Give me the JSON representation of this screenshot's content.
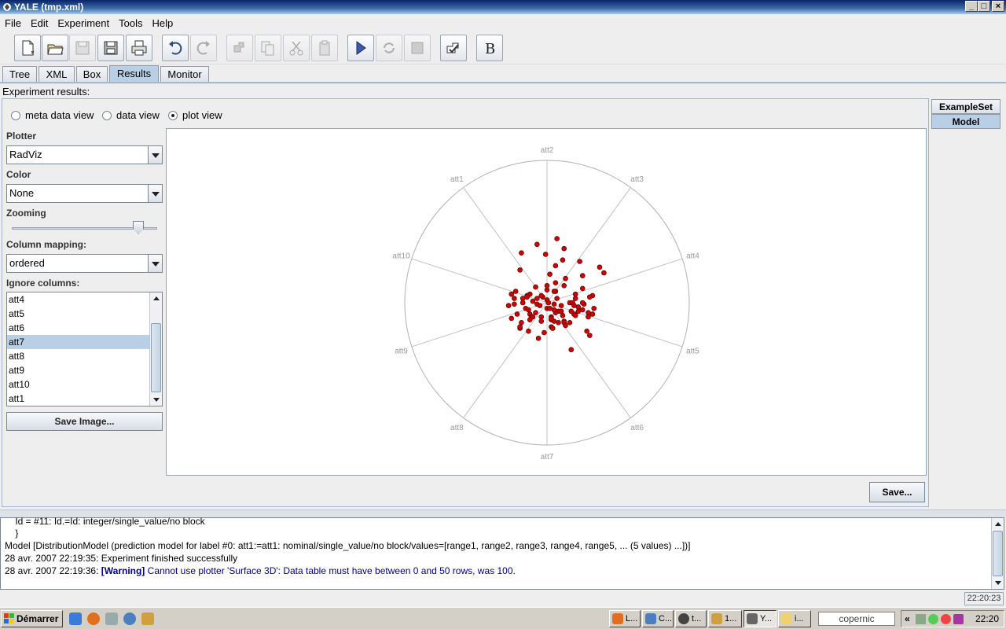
{
  "window": {
    "title": "YALE (tmp.xml)",
    "controls": [
      "_",
      "□",
      "×"
    ]
  },
  "menu": [
    "File",
    "Edit",
    "Experiment",
    "Tools",
    "Help"
  ],
  "toolbar": {
    "buttons": [
      {
        "name": "new-icon",
        "enabled": true
      },
      {
        "name": "open-icon",
        "enabled": true
      },
      {
        "name": "save-icon",
        "enabled": false
      },
      {
        "name": "save-as-icon",
        "enabled": true
      },
      {
        "name": "print-icon",
        "enabled": true
      },
      {
        "name": "undo-icon",
        "enabled": true
      },
      {
        "name": "redo-icon",
        "enabled": false
      },
      {
        "name": "wizard-icon",
        "enabled": false
      },
      {
        "name": "copy-icon",
        "enabled": false
      },
      {
        "name": "cut-icon",
        "enabled": false
      },
      {
        "name": "paste-icon",
        "enabled": false
      },
      {
        "name": "run-icon",
        "enabled": true
      },
      {
        "name": "resume-icon",
        "enabled": false
      },
      {
        "name": "stop-icon",
        "enabled": false
      },
      {
        "name": "validate-icon",
        "enabled": true
      },
      {
        "name": "breakpoint-icon",
        "enabled": true
      }
    ]
  },
  "tabs": [
    {
      "label": "Tree"
    },
    {
      "label": "XML"
    },
    {
      "label": "Box"
    },
    {
      "label": "Results",
      "active": true
    },
    {
      "label": "Monitor"
    }
  ],
  "results": {
    "title": "Experiment results:",
    "views": [
      {
        "label": "meta data view",
        "selected": false
      },
      {
        "label": "data view",
        "selected": false
      },
      {
        "label": "plot view",
        "selected": true
      }
    ],
    "side_tabs": [
      {
        "label": "ExampleSet"
      },
      {
        "label": "Model",
        "active": true
      }
    ],
    "save_label": "Save..."
  },
  "plotter": {
    "plotter_label": "Plotter",
    "plotter_value": "RadViz",
    "color_label": "Color",
    "color_value": "None",
    "zooming_label": "Zooming",
    "zoom_fraction": 0.88,
    "mapping_label": "Column mapping:",
    "mapping_value": "ordered",
    "ignore_label": "Ignore columns:",
    "ignore_items": [
      "att4",
      "att5",
      "att6",
      "att7",
      "att8",
      "att9",
      "att10",
      "att1"
    ],
    "ignore_selected": "att7",
    "save_image_label": "Save Image..."
  },
  "chart_data": {
    "type": "scatter",
    "plot": "RadViz",
    "anchors": [
      "att2",
      "att3",
      "att4",
      "att5",
      "att6",
      "att7",
      "att8",
      "att9",
      "att10",
      "att1"
    ],
    "point_color": "#cc0000",
    "x": [
      0.07,
      0.12,
      -0.01,
      0.23,
      0.37,
      0.11,
      0.06,
      -0.19,
      0.4,
      0.25,
      0.13,
      0.06,
      0.02,
      -0.08,
      0.25,
      0.12,
      0.06,
      0.0,
      -0.12,
      -0.22,
      -0.25,
      -0.23,
      0.32,
      -0.14,
      -0.07,
      0.2,
      0.0,
      0.16,
      0.3,
      0.2,
      0.07,
      -0.17,
      -0.17,
      -0.23,
      -0.07,
      -0.05,
      0.26,
      0.18,
      0.19,
      0.22,
      0.22,
      0.33,
      0.25,
      0.29,
      0.19,
      0.29,
      0.32,
      0.11,
      -0.04,
      0.08,
      -0.21,
      -0.25,
      -0.12,
      -0.15,
      -0.11,
      0.08,
      0.12,
      -0.1,
      0.03,
      -0.12,
      -0.18,
      -0.19,
      -0.19,
      0.28,
      0.12,
      0.13,
      0.03,
      0.05,
      0.03,
      0.06,
      0.05,
      0.17,
      0.1,
      0.0,
      -0.13,
      0.05,
      0.25,
      0.02,
      -0.08,
      -0.04,
      -0.03,
      -0.1,
      -0.14,
      0.0,
      0.05,
      0.01,
      -0.04,
      -0.13,
      -0.27,
      0.03,
      0.1,
      0.04,
      -0.02,
      -0.06,
      0.16,
      0.2,
      0.3,
      -0.07,
      -0.18,
      0.17
    ],
    "y": [
      0.45,
      0.38,
      0.34,
      0.29,
      0.25,
      0.3,
      0.26,
      0.23,
      0.21,
      0.19,
      0.17,
      0.14,
      0.2,
      0.11,
      0.1,
      0.12,
      0.08,
      0.09,
      0.06,
      0.08,
      0.06,
      0.03,
      0.05,
      0.05,
      0.03,
      0.06,
      0.02,
      0.0,
      0.04,
      0.03,
      0.03,
      0.03,
      0.0,
      -0.01,
      -0.01,
      -0.02,
      -0.01,
      0.0,
      -0.02,
      -0.03,
      -0.06,
      -0.04,
      -0.05,
      -0.07,
      -0.08,
      -0.1,
      -0.08,
      -0.09,
      -0.1,
      -0.06,
      -0.08,
      -0.11,
      -0.08,
      -0.04,
      -0.1,
      -0.14,
      -0.13,
      -0.1,
      -0.12,
      -0.12,
      -0.14,
      -0.18,
      -0.17,
      -0.2,
      -0.14,
      -0.16,
      -0.17,
      -0.13,
      -0.1,
      -0.07,
      -0.05,
      -0.06,
      -0.02,
      -0.04,
      -0.05,
      -0.01,
      0.0,
      -0.04,
      -0.07,
      -0.13,
      0.04,
      0.01,
      0.04,
      0.12,
      0.08,
      0.0,
      0.05,
      -0.2,
      -0.02,
      -0.11,
      -0.06,
      -0.18,
      -0.21,
      -0.25,
      -0.14,
      -0.09,
      -0.23,
      0.41,
      0.35,
      -0.33
    ]
  },
  "log": {
    "lines": [
      {
        "prefix": "    Id = #11: Id.=Id: integer/single_value/no block",
        "warning": "",
        "message": ""
      },
      {
        "prefix": "    }",
        "warning": "",
        "message": ""
      },
      {
        "prefix": "Model [DistributionModel (prediction model for label #0: att1:=att1: nominal/single_value/no block/values=[range1, range2, range3, range4, range5, ... (5 values) ...])]",
        "warning": "",
        "message": ""
      },
      {
        "prefix": "28 avr. 2007 22:19:35: Experiment finished successfully",
        "warning": "",
        "message": ""
      },
      {
        "prefix": "28 avr. 2007 22:19:36: ",
        "warning": "[Warning]",
        "message": " Cannot use plotter 'Surface 3D': Data table must have between 0 and 50 rows, was 100."
      }
    ]
  },
  "status": {
    "time": "22:20:23"
  },
  "taskbar": {
    "start_label": "Démarrer",
    "tasks": [
      {
        "label": "L...",
        "active": false
      },
      {
        "label": "C...",
        "active": false
      },
      {
        "label": "t...",
        "active": false
      },
      {
        "label": "1...",
        "active": false
      },
      {
        "label": "Y...",
        "active": true
      },
      {
        "label": "i...",
        "active": false
      }
    ],
    "search_text": "copernic",
    "tray_chevron": "«",
    "clock": "22:20"
  },
  "colors": {
    "accent": "#b8cfe5",
    "point": "#cc0000",
    "warning": "#000080"
  }
}
